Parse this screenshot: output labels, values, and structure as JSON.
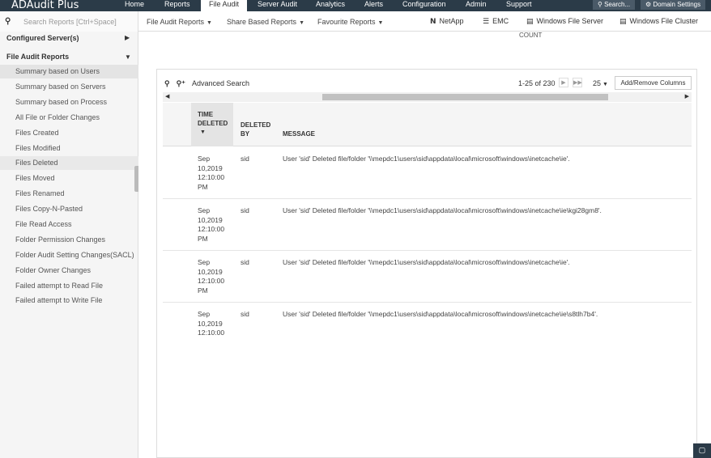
{
  "app": {
    "title": "ADAudit Plus"
  },
  "nav": {
    "items": [
      "Home",
      "Reports",
      "File Audit",
      "Server Audit",
      "Analytics",
      "Alerts",
      "Configuration",
      "Admin",
      "Support"
    ],
    "search_label": "Search...",
    "domain_settings_label": "Domain Settings"
  },
  "toolbar": {
    "search_placeholder": "Search Reports [Ctrl+Space]",
    "menus": [
      "File Audit Reports",
      "Share Based Reports",
      "Favourite Reports"
    ],
    "vendors": [
      "NetApp",
      "EMC",
      "Windows File Server",
      "Windows File Cluster"
    ]
  },
  "count_label": "COUNT",
  "sidebar": {
    "configured_servers": "Configured Server(s)",
    "section_title": "File Audit Reports",
    "items": [
      "Summary based on Users",
      "Summary based on Servers",
      "Summary based on Process",
      "All File or Folder Changes",
      "Files Created",
      "Files Modified",
      "Files Deleted",
      "Files Moved",
      "Files Renamed",
      "Files Copy-N-Pasted",
      "File Read Access",
      "Folder Permission Changes",
      "Folder Audit Setting Changes(SACL)",
      "Folder Owner Changes",
      "Failed attempt to Read File",
      "Failed attempt to Write File"
    ]
  },
  "report": {
    "advanced_search": "Advanced Search",
    "pager_text": "1-25 of 230",
    "per_page": "25",
    "add_remove_columns": "Add/Remove Columns",
    "columns": {
      "time": "TIME DELETED",
      "by": "DELETED BY",
      "message": "MESSAGE"
    },
    "rows": [
      {
        "date": "Sep 10,2019",
        "time": "12:10:00",
        "ampm": "PM",
        "by": "sid",
        "message": "User 'sid' Deleted file/folder '\\\\mepdc1\\users\\sid\\appdata\\local\\microsoft\\windows\\inetcache\\ie'."
      },
      {
        "date": "Sep 10,2019",
        "time": "12:10:00",
        "ampm": "PM",
        "by": "sid",
        "message": "User 'sid' Deleted file/folder '\\\\mepdc1\\users\\sid\\appdata\\local\\microsoft\\windows\\inetcache\\ie\\kgi28gm8'."
      },
      {
        "date": "Sep 10,2019",
        "time": "12:10:00",
        "ampm": "PM",
        "by": "sid",
        "message": "User 'sid' Deleted file/folder '\\\\mepdc1\\users\\sid\\appdata\\local\\microsoft\\windows\\inetcache\\ie'."
      },
      {
        "date": "Sep 10,2019",
        "time": "12:10:00",
        "ampm": "",
        "by": "sid",
        "message": "User 'sid' Deleted file/folder '\\\\mepdc1\\users\\sid\\appdata\\local\\microsoft\\windows\\inetcache\\ie\\s8tlh7b4'."
      }
    ]
  },
  "colors": {
    "topbar": "#2b3b48",
    "sidebar_bg": "#f5f5f5",
    "selected": "#e4e4e4"
  },
  "icons": {
    "search": "search-icon",
    "advanced_search": "advanced-search-icon",
    "chat": "chat-icon"
  }
}
